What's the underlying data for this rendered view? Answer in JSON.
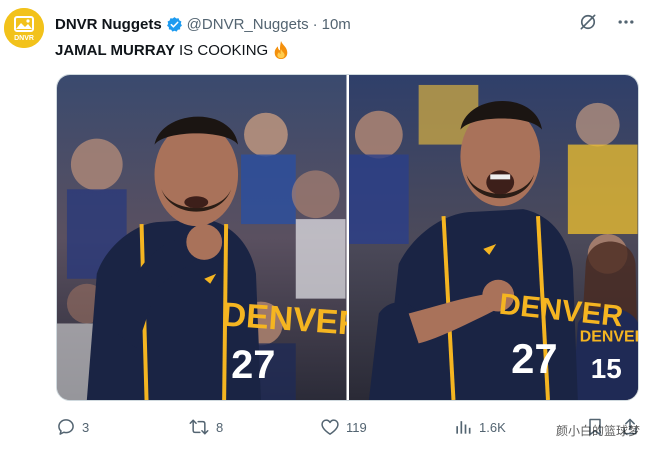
{
  "account": {
    "display_name": "DNVR Nuggets",
    "handle": "@DNVR_Nuggets",
    "separator": "·",
    "time": "10m",
    "avatar_text": "DNVR",
    "avatar_color": "#f2c21b",
    "verified_color": "#1d9bf0"
  },
  "header_icons": [
    "grok-icon",
    "more-icon"
  ],
  "tweet": {
    "text_bold": "JAMAL MURRAY",
    "text_rest": "IS COOKING",
    "emoji": "fire-icon"
  },
  "media": {
    "photo_left": {
      "jersey_text": "DENVER",
      "jersey_number": "27"
    },
    "photo_right": {
      "jersey_text": "DENVER",
      "jersey_number": "27",
      "fan_jersey_text": "DENVER",
      "fan_jersey_number": "15"
    }
  },
  "actions": {
    "replies": "3",
    "retweets": "8",
    "likes": "119",
    "views": "1.6K"
  },
  "watermark": "颜小白的篮球梦"
}
